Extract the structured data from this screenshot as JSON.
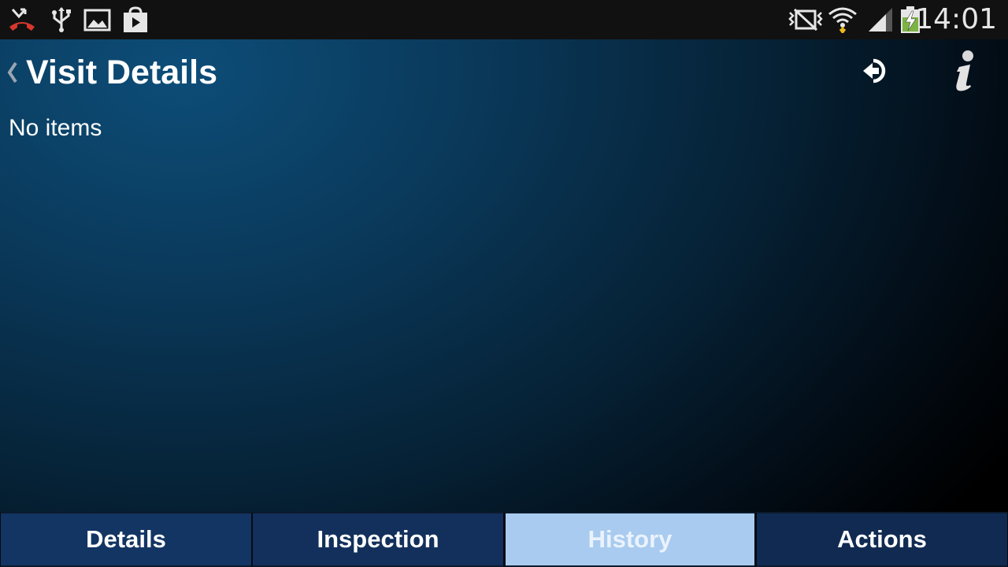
{
  "status_bar": {
    "time": "14:01",
    "left_icons": [
      "missed-call-icon",
      "usb-icon",
      "gallery-icon",
      "play-store-icon"
    ],
    "right_icons": [
      "silent-mode-icon",
      "wifi-icon",
      "signal-icon",
      "battery-charging-icon"
    ]
  },
  "header": {
    "title": "Visit Details",
    "actions": [
      "logout-icon",
      "info-icon"
    ]
  },
  "content": {
    "empty_message": "No items"
  },
  "tabs": [
    {
      "label": "Details",
      "selected": false
    },
    {
      "label": "Inspection",
      "selected": false
    },
    {
      "label": "History",
      "selected": true
    },
    {
      "label": "Actions",
      "selected": false
    }
  ],
  "colors": {
    "tab_selected": "#a9cbef",
    "tab_default": "#133563",
    "background_accent": "#0d4d78"
  }
}
